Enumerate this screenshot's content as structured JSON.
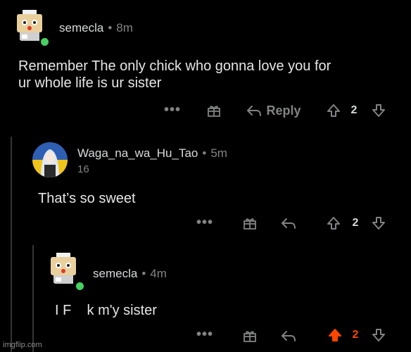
{
  "comments": [
    {
      "username": "semecla",
      "separator": "•",
      "time": "8m",
      "body_lines": [
        "Remember The only chick who gonna love you for",
        "ur whole life is ur sister"
      ],
      "more": "•••",
      "reply_label": "Reply",
      "score": "2"
    },
    {
      "username": "Waga_na_wa_Hu_Tao",
      "separator": "•",
      "time": "5m",
      "karma": "16",
      "body_lines": [
        "That’s so sweet"
      ],
      "more": "•••",
      "score": "2"
    },
    {
      "username": "semecla",
      "separator": "•",
      "time": "4m",
      "body_lines": [
        "I F    k m'y sister"
      ],
      "more": "•••",
      "score": "2",
      "upvoted": true
    }
  ],
  "colors": {
    "background": "#000000",
    "upvote_active": "#ff4500",
    "online": "#46d160",
    "muted": "#818384"
  },
  "icons": [
    "robot-avatar-icon",
    "anime-avatar-icon",
    "more-icon",
    "gift-award-icon",
    "reply-arrow-icon",
    "upvote-icon",
    "downvote-icon"
  ],
  "watermark": "imgflip.com"
}
